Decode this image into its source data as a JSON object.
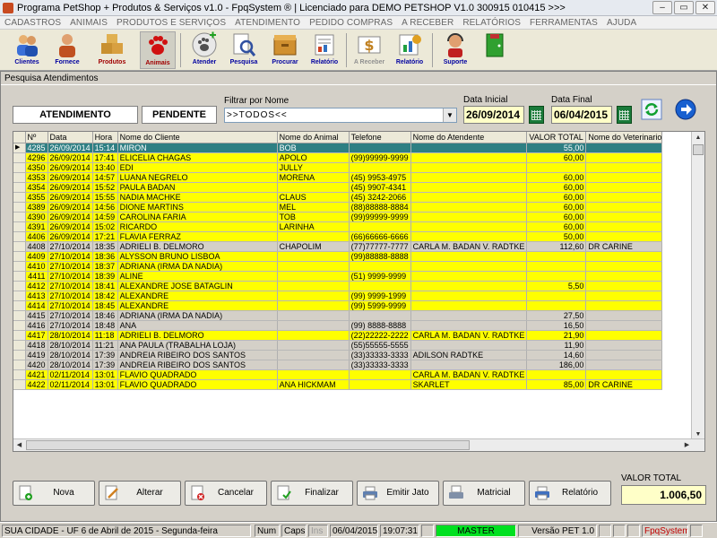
{
  "window": {
    "title": "Programa PetShop + Produtos & Serviços v1.0 - FpqSystem ® | Licenciado para  DEMO PETSHOP V1.0 300915 010415 >>>"
  },
  "menu": [
    "CADASTROS",
    "ANIMAIS",
    "PRODUTOS E SERVIÇOS",
    "ATENDIMENTO",
    "PEDIDO COMPRAS",
    "A RECEBER",
    "RELATÓRIOS",
    "FERRAMENTAS",
    "AJUDA"
  ],
  "toolbar": {
    "clientes": "Clientes",
    "fornece": "Fornece",
    "produtos": "Produtos",
    "animais": "Animais",
    "atender": "Atender",
    "pesquisa": "Pesquisa",
    "procurar": "Procurar",
    "relatorio1": "Relatório",
    "areceber": "A Receber",
    "relatorio2": "Relatório",
    "suporte": "Suporte"
  },
  "form": {
    "title": "Pesquisa Atendimentos",
    "tab_atendimento": "ATENDIMENTO",
    "tab_pendente": "PENDENTE",
    "filter_label": "Filtrar por Nome",
    "filter_value": ">>TODOS<<",
    "data_inicial_label": "Data Inicial",
    "data_inicial": "26/09/2014",
    "data_final_label": "Data Final",
    "data_final": "06/04/2015"
  },
  "table": {
    "columns": [
      "Nº",
      "Data",
      "Hora",
      "Nome do Cliente",
      "Nome do Animal",
      "Telefone",
      "Nome do Atendente",
      "VALOR TOTAL",
      "Nome do Veterinario"
    ],
    "rows": [
      {
        "n": "4285",
        "data": "26/09/2014",
        "hora": "15:14",
        "cliente": "MIRON",
        "animal": "BOB",
        "tel": "",
        "atendente": "",
        "valor": "55,00",
        "vet": "",
        "style": "s"
      },
      {
        "n": "4296",
        "data": "26/09/2014",
        "hora": "17:41",
        "cliente": "ELICELIA CHAGAS",
        "animal": "APOLO",
        "tel": "(99)99999-9999",
        "atendente": "",
        "valor": "60,00",
        "vet": "",
        "style": "y"
      },
      {
        "n": "4350",
        "data": "26/09/2014",
        "hora": "13:40",
        "cliente": "EDI",
        "animal": "JULLY",
        "tel": "",
        "atendente": "",
        "valor": "",
        "vet": "",
        "style": "y"
      },
      {
        "n": "4353",
        "data": "26/09/2014",
        "hora": "14:57",
        "cliente": "LUANA NEGRELO",
        "animal": "MORENA",
        "tel": "(45) 9953-4975",
        "atendente": "",
        "valor": "60,00",
        "vet": "",
        "style": "y"
      },
      {
        "n": "4354",
        "data": "26/09/2014",
        "hora": "15:52",
        "cliente": "PAULA BADAN",
        "animal": "",
        "tel": "(45) 9907-4341",
        "atendente": "",
        "valor": "60,00",
        "vet": "",
        "style": "y"
      },
      {
        "n": "4355",
        "data": "26/09/2014",
        "hora": "15:55",
        "cliente": "NADIA MACHKE",
        "animal": "CLAUS",
        "tel": "(45) 3242-2066",
        "atendente": "",
        "valor": "60,00",
        "vet": "",
        "style": "y"
      },
      {
        "n": "4389",
        "data": "26/09/2014",
        "hora": "14:56",
        "cliente": "DIONE MARTINS",
        "animal": "MEL",
        "tel": "(88)88888-8884",
        "atendente": "",
        "valor": "60,00",
        "vet": "",
        "style": "y"
      },
      {
        "n": "4390",
        "data": "26/09/2014",
        "hora": "14:59",
        "cliente": "CAROLINA FARIA",
        "animal": "TOB",
        "tel": "(99)99999-9999",
        "atendente": "",
        "valor": "60,00",
        "vet": "",
        "style": "y"
      },
      {
        "n": "4391",
        "data": "26/09/2014",
        "hora": "15:02",
        "cliente": "RICARDO",
        "animal": "LARINHA",
        "tel": "",
        "atendente": "",
        "valor": "60,00",
        "vet": "",
        "style": "y"
      },
      {
        "n": "4406",
        "data": "26/09/2014",
        "hora": "17:21",
        "cliente": "FLAVIA FERRAZ",
        "animal": "",
        "tel": "(66)66666-6666",
        "atendente": "",
        "valor": "50,00",
        "vet": "",
        "style": "y"
      },
      {
        "n": "4408",
        "data": "27/10/2014",
        "hora": "18:35",
        "cliente": "ADRIELI B. DELMORO",
        "animal": "CHAPOLIM",
        "tel": "(77)77777-7777",
        "atendente": "CARLA M. BADAN V. RADTKE",
        "valor": "112,60",
        "vet": "DR CARINE",
        "style": "w"
      },
      {
        "n": "4409",
        "data": "27/10/2014",
        "hora": "18:36",
        "cliente": "ALYSSON BRUNO LISBOA",
        "animal": "",
        "tel": "(99)88888-8888",
        "atendente": "",
        "valor": "",
        "vet": "",
        "style": "y"
      },
      {
        "n": "4410",
        "data": "27/10/2014",
        "hora": "18:37",
        "cliente": "ADRIANA (IRMA DA NADIA)",
        "animal": "",
        "tel": "",
        "atendente": "",
        "valor": "",
        "vet": "",
        "style": "y"
      },
      {
        "n": "4411",
        "data": "27/10/2014",
        "hora": "18:39",
        "cliente": "ALINE",
        "animal": "",
        "tel": "(51) 9999-9999",
        "atendente": "",
        "valor": "",
        "vet": "",
        "style": "y"
      },
      {
        "n": "4412",
        "data": "27/10/2014",
        "hora": "18:41",
        "cliente": "ALEXANDRE JOSE BATAGLIN",
        "animal": "",
        "tel": "",
        "atendente": "",
        "valor": "5,50",
        "vet": "",
        "style": "y"
      },
      {
        "n": "4413",
        "data": "27/10/2014",
        "hora": "18:42",
        "cliente": "ALEXANDRE",
        "animal": "",
        "tel": "(99) 9999-1999",
        "atendente": "",
        "valor": "",
        "vet": "",
        "style": "y"
      },
      {
        "n": "4414",
        "data": "27/10/2014",
        "hora": "18:45",
        "cliente": "ALEXANDRE",
        "animal": "",
        "tel": "(99) 5999-9999",
        "atendente": "",
        "valor": "",
        "vet": "",
        "style": "y"
      },
      {
        "n": "4415",
        "data": "27/10/2014",
        "hora": "18:46",
        "cliente": "ADRIANA (IRMA DA NADIA)",
        "animal": "",
        "tel": "",
        "atendente": "",
        "valor": "27,50",
        "vet": "",
        "style": "w"
      },
      {
        "n": "4416",
        "data": "27/10/2014",
        "hora": "18:48",
        "cliente": "ANA",
        "animal": "",
        "tel": "(99) 8888-8888",
        "atendente": "",
        "valor": "16,50",
        "vet": "",
        "style": "w"
      },
      {
        "n": "4417",
        "data": "28/10/2014",
        "hora": "11:18",
        "cliente": "ADRIELI B. DELMORO",
        "animal": "",
        "tel": "(22)22222-2222",
        "atendente": "CARLA M. BADAN V. RADTKE",
        "valor": "21,90",
        "vet": "",
        "style": "y"
      },
      {
        "n": "4418",
        "data": "28/10/2014",
        "hora": "11:21",
        "cliente": "ANA PAULA (TRABALHA LOJA)",
        "animal": "",
        "tel": "(55)55555-5555",
        "atendente": "",
        "valor": "11,90",
        "vet": "",
        "style": "w"
      },
      {
        "n": "4419",
        "data": "28/10/2014",
        "hora": "17:39",
        "cliente": "ANDREIA RIBEIRO DOS SANTOS",
        "animal": "",
        "tel": "(33)33333-3333",
        "atendente": "ADILSON RADTKE",
        "valor": "14,60",
        "vet": "",
        "style": "w"
      },
      {
        "n": "4420",
        "data": "28/10/2014",
        "hora": "17:39",
        "cliente": "ANDREIA RIBEIRO DOS SANTOS",
        "animal": "",
        "tel": "(33)33333-3333",
        "atendente": "",
        "valor": "186,00",
        "vet": "",
        "style": "w"
      },
      {
        "n": "4421",
        "data": "02/11/2014",
        "hora": "13:01",
        "cliente": "FLAVIO QUADRADO",
        "animal": "",
        "tel": "",
        "atendente": "CARLA M. BADAN V. RADTKE",
        "valor": "",
        "vet": "",
        "style": "y"
      },
      {
        "n": "4422",
        "data": "02/11/2014",
        "hora": "13:01",
        "cliente": "FLAVIO QUADRADO",
        "animal": "ANA HICKMAM",
        "tel": "",
        "atendente": "SKARLET",
        "valor": "85,00",
        "vet": "DR CARINE",
        "style": "y"
      }
    ]
  },
  "buttons": {
    "nova": "Nova",
    "alterar": "Alterar",
    "cancelar": "Cancelar",
    "finalizar": "Finalizar",
    "emitir": "Emitir Jato",
    "matricial": "Matricial",
    "relatorio": "Relatório"
  },
  "total": {
    "label": "VALOR TOTAL",
    "value": "1.006,50"
  },
  "status": {
    "cidade": "SUA CIDADE - UF  6 de Abril de 2015 - Segunda-feira",
    "num": "Num",
    "caps": "Caps",
    "ins": "Ins",
    "date": "06/04/2015",
    "time": "19:07:31",
    "user": "MASTER",
    "versao": "Versão PET 1.0",
    "brand": "FpqSystem"
  },
  "colors": {
    "selected_row": "#2e7f83",
    "pending_row": "#ffff00",
    "closed_row": "#d4d0c8",
    "status_green": "#00e020"
  }
}
